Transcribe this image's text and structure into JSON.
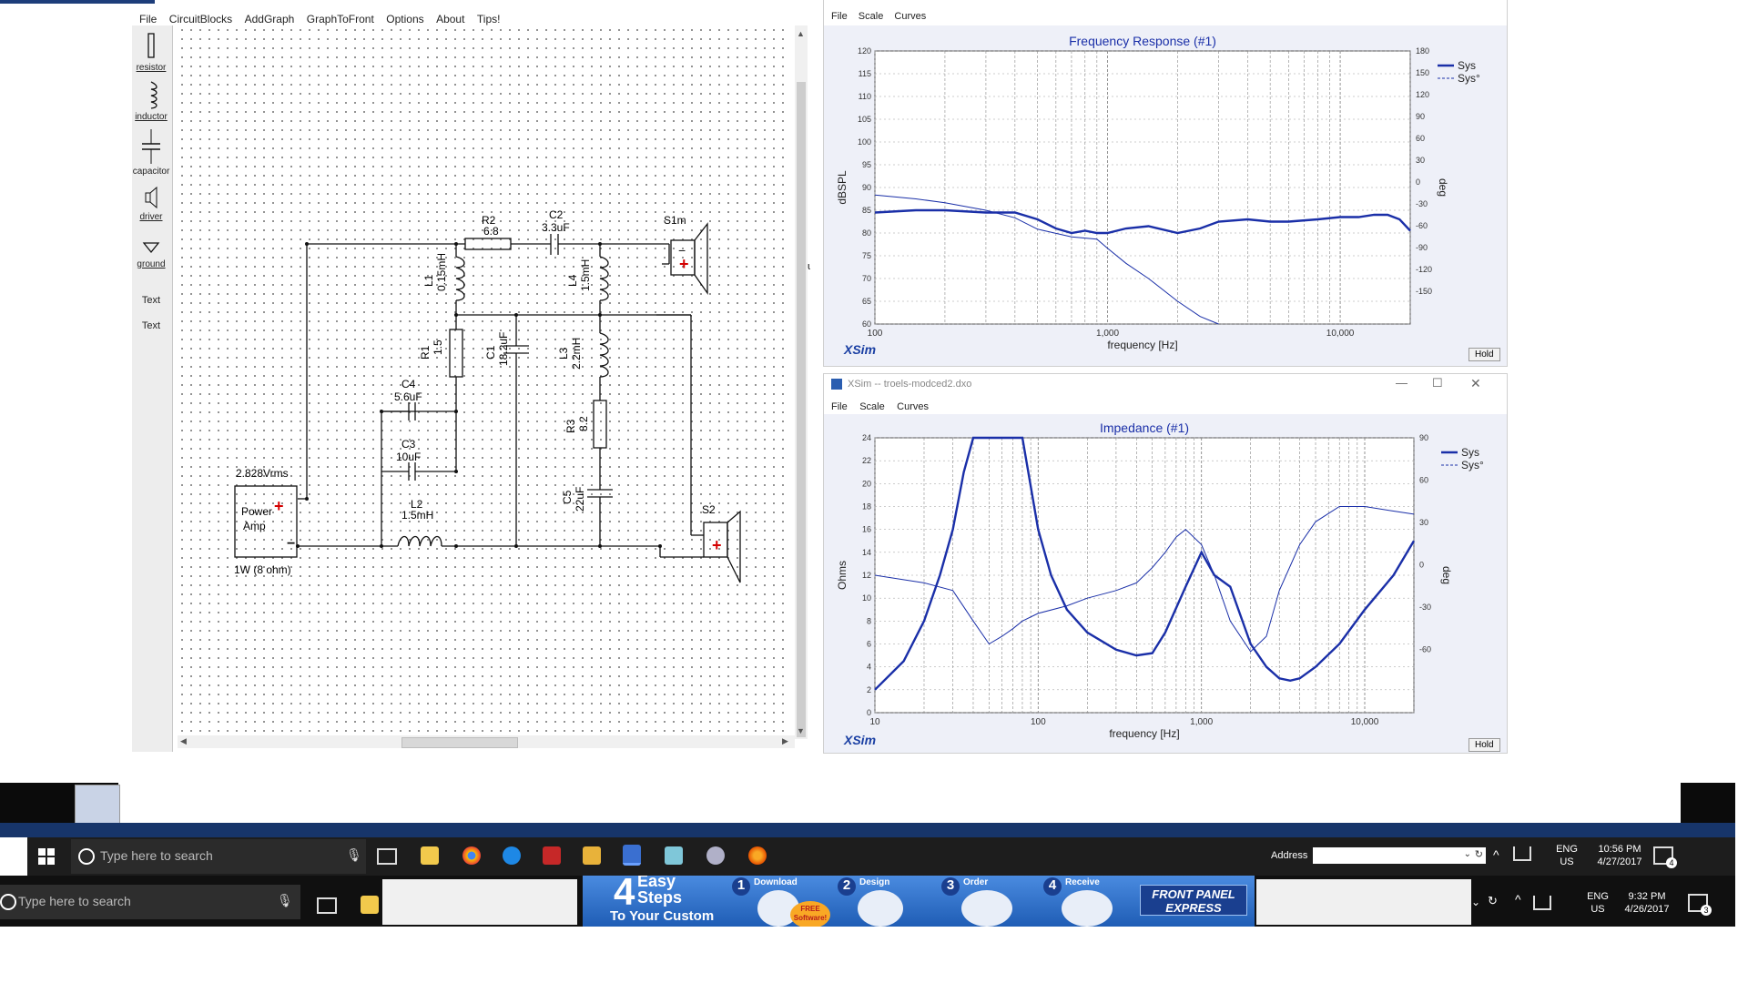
{
  "xsim_circuit": {
    "menu": [
      "File",
      "CircuitBlocks",
      "AddGraph",
      "GraphToFront",
      "Options",
      "About",
      "Tips!"
    ],
    "toolbox": [
      {
        "label": "resistor",
        "icon": "resistor-icon"
      },
      {
        "label": "inductor",
        "icon": "inductor-icon"
      },
      {
        "label": "capacitor",
        "icon": "capacitor-icon"
      },
      {
        "label": "driver",
        "icon": "driver-icon"
      },
      {
        "label": "ground",
        "icon": "ground-icon"
      },
      {
        "label": "Text",
        "icon": "text-tool"
      },
      {
        "label": "Text",
        "icon": "text-tool"
      }
    ],
    "schematic": {
      "R2": "R2",
      "R2_val": "6.8",
      "C2": "C2",
      "C2_val": "3.3uF",
      "S1m": "S1m",
      "L1": "L1",
      "L1_val": "0.15mH",
      "L4": "L4",
      "L4_val": "1.5mH",
      "R1": "R1",
      "R1_val": "1.5",
      "C1": "C1",
      "C1_val": "18.2uF",
      "L3": "L3",
      "L3_val": "2.2mH",
      "C4": "C4",
      "C4_val": "5.6uF",
      "C3": "C3",
      "C3_val": "10uF",
      "R3": "R3",
      "R3_val": "8.2",
      "C5": "C5",
      "C5_val": "22uF",
      "L2": "L2",
      "L2_val": "1.5mH",
      "S2": "S2",
      "amp_voltage": "2.828Vrms",
      "amp_line1": "Power",
      "amp_line2": "Amp",
      "amp_note": "1W (8 ohm)"
    },
    "partial_label": "um"
  },
  "freq_window": {
    "menu": [
      "File",
      "Scale",
      "Curves"
    ],
    "chart_title": "Frequency Response (#1)",
    "ylabel": "dBSPL",
    "y2label": "deg",
    "xlabel": "frequency [Hz]",
    "y_ticks": [
      "120",
      "115",
      "110",
      "105",
      "100",
      "95",
      "90",
      "85",
      "80",
      "75",
      "70",
      "65",
      "60"
    ],
    "y2_ticks": [
      "180",
      "150",
      "120",
      "90",
      "60",
      "30",
      "0",
      "-30",
      "-60",
      "-90",
      "-120",
      "-150"
    ],
    "x_ticks": [
      "100",
      "1,000",
      "10,000"
    ],
    "legend": [
      "Sys",
      "Sys°"
    ],
    "brand": "XSim",
    "hold": "Hold"
  },
  "imp_window": {
    "title": "XSim -- troels-modced2.dxo",
    "menu": [
      "File",
      "Scale",
      "Curves"
    ],
    "chart_title": "Impedance (#1)",
    "ylabel": "Ohms",
    "y2label": "deg",
    "xlabel": "frequency [Hz]",
    "y_ticks": [
      "24",
      "22",
      "20",
      "18",
      "16",
      "14",
      "12",
      "10",
      "8",
      "6",
      "4",
      "2",
      "0"
    ],
    "y2_ticks": [
      "90",
      "60",
      "30",
      "0",
      "-30",
      "-60"
    ],
    "x_ticks": [
      "10",
      "100",
      "1,000",
      "10,000"
    ],
    "legend": [
      "Sys",
      "Sys°"
    ],
    "brand": "XSim",
    "hold": "Hold"
  },
  "chart_data": [
    {
      "type": "line",
      "title": "Frequency Response (#1)",
      "xlabel": "frequency [Hz]",
      "ylabel": "dBSPL",
      "xscale": "log",
      "xlim": [
        100,
        20000
      ],
      "ylim": [
        60,
        120
      ],
      "y2lim": [
        -180,
        180
      ],
      "grid": true,
      "legend_position": "top-right",
      "series": [
        {
          "name": "Sys",
          "axis": "left",
          "color": "#1a2fa8",
          "width": "bold",
          "x": [
            100,
            150,
            200,
            300,
            400,
            500,
            600,
            700,
            800,
            900,
            1000,
            1200,
            1500,
            2000,
            2500,
            3000,
            4000,
            5000,
            6000,
            8000,
            10000,
            12000,
            14000,
            16000,
            18000,
            20000
          ],
          "y": [
            84.5,
            85,
            85,
            84.5,
            84.5,
            83,
            81,
            80,
            80.5,
            80,
            80,
            81,
            81.5,
            80,
            81,
            82.5,
            83,
            82.5,
            82.5,
            83,
            83.5,
            83.5,
            84,
            84,
            83,
            80.5
          ]
        },
        {
          "name": "Sys°",
          "axis": "right",
          "color": "#1a2fa8",
          "width": "thin",
          "x": [
            100,
            150,
            200,
            300,
            400,
            500,
            700,
            900,
            1000,
            1200,
            1500,
            2000,
            2500,
            3000
          ],
          "y": [
            -10,
            -15,
            -20,
            -30,
            -40,
            -55,
            -65,
            -68,
            -80,
            -100,
            -120,
            -150,
            -170,
            -180
          ]
        }
      ]
    },
    {
      "type": "line",
      "title": "Impedance (#1)",
      "xlabel": "frequency [Hz]",
      "ylabel": "Ohms",
      "xscale": "log",
      "xlim": [
        10,
        20000
      ],
      "ylim": [
        0,
        24
      ],
      "y2lim": [
        -90,
        90
      ],
      "grid": true,
      "legend_position": "top-right",
      "series": [
        {
          "name": "Sys",
          "axis": "left",
          "color": "#1a2fa8",
          "width": "bold",
          "x": [
            10,
            15,
            20,
            25,
            30,
            35,
            40,
            50,
            60,
            70,
            80,
            100,
            120,
            150,
            200,
            300,
            400,
            500,
            600,
            800,
            1000,
            1200,
            1500,
            2000,
            2500,
            3000,
            3500,
            4000,
            5000,
            7000,
            10000,
            15000,
            20000
          ],
          "y": [
            2,
            4.5,
            8,
            12,
            16,
            21,
            24,
            24,
            24,
            24,
            24,
            16,
            12,
            9,
            7,
            5.5,
            5,
            5.2,
            7,
            11,
            14,
            12,
            11,
            6,
            4,
            3,
            2.8,
            3,
            4,
            6,
            9,
            12,
            15
          ]
        },
        {
          "name": "Sys°",
          "axis": "right",
          "color": "#1a2fa8",
          "width": "thin",
          "x": [
            10,
            20,
            30,
            40,
            50,
            60,
            70,
            80,
            100,
            150,
            200,
            300,
            400,
            500,
            600,
            700,
            800,
            1000,
            1200,
            1500,
            2000,
            2500,
            3000,
            4000,
            5000,
            7000,
            10000,
            15000,
            20000
          ],
          "y": [
            0,
            -5,
            -10,
            -30,
            -45,
            -40,
            -35,
            -30,
            -25,
            -20,
            -15,
            -10,
            -5,
            5,
            15,
            25,
            30,
            20,
            0,
            -30,
            -50,
            -40,
            -10,
            20,
            35,
            45,
            45,
            42,
            40
          ]
        }
      ]
    }
  ],
  "taskbar_upper": {
    "search_placeholder": "Type here to search",
    "address_label": "Address",
    "lang": "ENG",
    "region": "US",
    "time": "10:56 PM",
    "date": "4/27/2017",
    "notif_count": "4"
  },
  "taskbar_lower": {
    "search_placeholder": "Type here to search",
    "lang": "ENG",
    "region": "US",
    "time": "9:32 PM",
    "date": "4/26/2017",
    "notif_count": "3"
  },
  "ad": {
    "big_number": "4",
    "line1": "Easy",
    "line2": "Steps",
    "line3": "To Your Custom",
    "steps": [
      {
        "n": "1",
        "label": "Download"
      },
      {
        "n": "2",
        "label": "Design"
      },
      {
        "n": "3",
        "label": "Order"
      },
      {
        "n": "4",
        "label": "Receive"
      }
    ],
    "free_badge_1": "FREE",
    "free_badge_2": "Software!",
    "brand_line1": "FRONT PANEL",
    "brand_line2": "EXPRESS"
  },
  "colors": {
    "curve": "#1a2fa8",
    "taskbar": "#1d1d1d",
    "red_plus": "#d40000",
    "ad_bg": "#2f6fc0"
  }
}
